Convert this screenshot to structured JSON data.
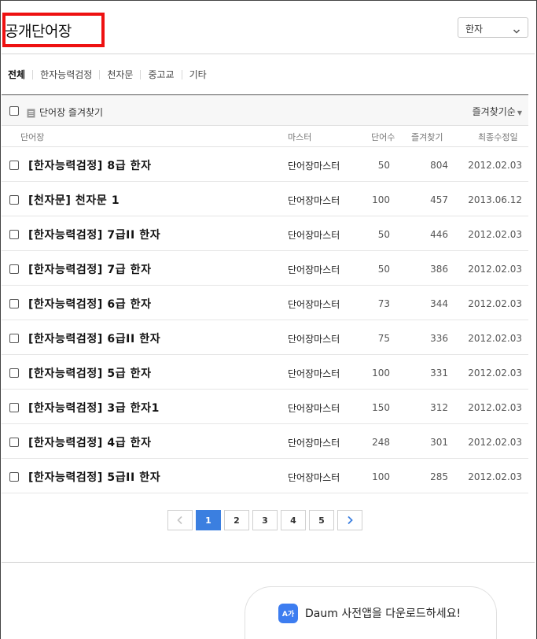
{
  "header": {
    "title": "공개단어장",
    "lang_select": "한자"
  },
  "tabs": [
    "전체",
    "한자능력검정",
    "천자문",
    "중고교",
    "기타"
  ],
  "toolbar": {
    "favorites_label": "단어장 즐겨찾기",
    "sort_label": "즐겨찾기순"
  },
  "columns": {
    "name": "단어장",
    "master": "마스터",
    "words": "단어수",
    "favorites": "즐겨찾기",
    "modified": "최종수정일"
  },
  "rows": [
    {
      "name": "[한자능력검정] 8급 한자",
      "master": "단어장마스터",
      "words": "50",
      "favorites": "804",
      "modified": "2012.02.03"
    },
    {
      "name": "[천자문] 천자문 1",
      "master": "단어장마스터",
      "words": "100",
      "favorites": "457",
      "modified": "2013.06.12"
    },
    {
      "name": "[한자능력검정] 7급II 한자",
      "master": "단어장마스터",
      "words": "50",
      "favorites": "446",
      "modified": "2012.02.03"
    },
    {
      "name": "[한자능력검정] 7급 한자",
      "master": "단어장마스터",
      "words": "50",
      "favorites": "386",
      "modified": "2012.02.03"
    },
    {
      "name": "[한자능력검정] 6급 한자",
      "master": "단어장마스터",
      "words": "73",
      "favorites": "344",
      "modified": "2012.02.03"
    },
    {
      "name": "[한자능력검정] 6급II 한자",
      "master": "단어장마스터",
      "words": "75",
      "favorites": "336",
      "modified": "2012.02.03"
    },
    {
      "name": "[한자능력검정] 5급 한자",
      "master": "단어장마스터",
      "words": "100",
      "favorites": "331",
      "modified": "2012.02.03"
    },
    {
      "name": "[한자능력검정] 3급 한자1",
      "master": "단어장마스터",
      "words": "150",
      "favorites": "312",
      "modified": "2012.02.03"
    },
    {
      "name": "[한자능력검정] 4급 한자",
      "master": "단어장마스터",
      "words": "248",
      "favorites": "301",
      "modified": "2012.02.03"
    },
    {
      "name": "[한자능력검정] 5급II 한자",
      "master": "단어장마스터",
      "words": "100",
      "favorites": "285",
      "modified": "2012.02.03"
    }
  ],
  "pagination": {
    "pages": [
      "1",
      "2",
      "3",
      "4",
      "5"
    ],
    "current": "1"
  },
  "app_banner": {
    "icon_text": "A가",
    "text": "Daum 사전앱을 다운로드하세요!"
  },
  "colors": {
    "accent": "#3b7fe0",
    "highlight_box": "#ee1111"
  }
}
